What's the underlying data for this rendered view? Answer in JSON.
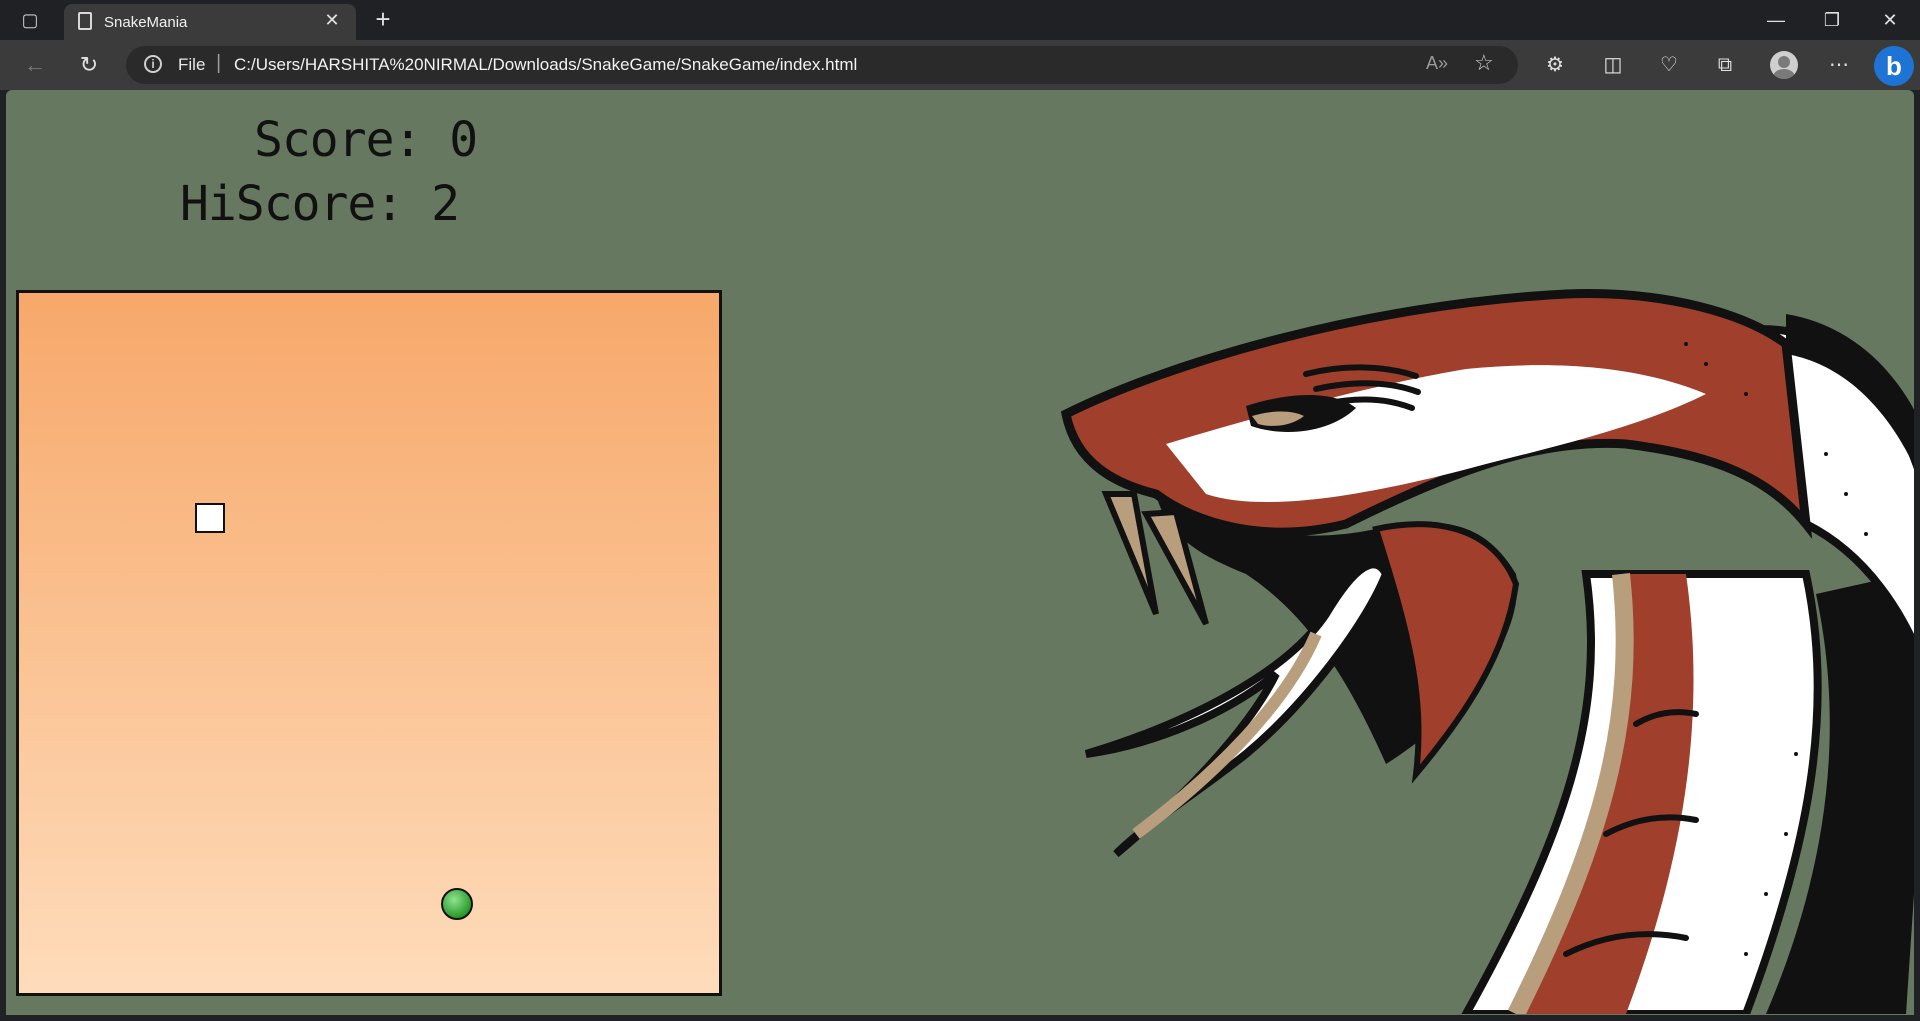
{
  "browser": {
    "tab_title": "SnakeMania",
    "address_scheme": "File",
    "address_url": "C:/Users/HARSHITA%20NIRMAL/Downloads/SnakeGame/SnakeGame/index.html"
  },
  "game": {
    "score_text": "Score: 0",
    "hiscore_text": "HiScore: 2",
    "score": 0,
    "hiscore": 2,
    "colors": {
      "background": "#677861",
      "board_top": "#f7a86a",
      "board_bottom": "#fedcbb",
      "snake_head": "#ffffff",
      "food": "#2a9b2a"
    }
  }
}
